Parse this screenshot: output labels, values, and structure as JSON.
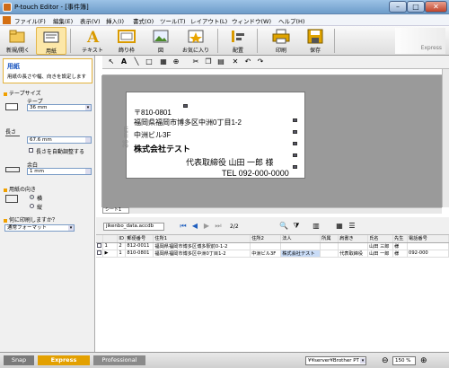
{
  "window": {
    "title": "P-touch Editor - [事件簿]",
    "controls": [
      "–",
      "□",
      "✕"
    ]
  },
  "menu": [
    "ファイル(F)",
    "編集(E)",
    "表示(V)",
    "挿入(I)",
    "書式(O)",
    "ツール(T)",
    "レイアウト(L)",
    "ウィンドウ(W)",
    "ヘルプ(H)"
  ],
  "ribbon": {
    "buttons": [
      "新規/開く",
      "用紙",
      "テキスト",
      "飾り枠",
      "図",
      "お気に入り",
      "配置",
      "印刷",
      "保存"
    ],
    "logo_text": "Express"
  },
  "left_panel": {
    "header_title": "用紙",
    "header_desc": "用紙の長さや幅、向きを設定します",
    "tape_size_label": "テープサイズ",
    "tape_label": "テープ",
    "tape_value": "36 mm",
    "length_label": "長さ",
    "length_value": "67.6 mm",
    "auto_length_label": "長さを自動調整する",
    "margin_label": "余白",
    "margin_value": "1 mm",
    "orientation_label": "用紙の向き",
    "orient_landscape": "横",
    "orient_portrait": "縦",
    "print_what_label": "何に印刷しますか？",
    "format_value": "通常フォーマット"
  },
  "label": {
    "side_text": "36 mm",
    "lines": [
      "〒810-0801",
      "福岡県福岡市博多区中洲0丁目1-2",
      "中洲ビル3F",
      "株式会社テスト",
      "代表取締役  山田  一郎  様",
      "TEL 092-000-0000"
    ]
  },
  "sheet_tab": "シート1",
  "database": {
    "filename": "jikenbo_data.accdb",
    "page": "2/2",
    "columns": [
      "",
      "",
      "ID",
      "郵便番号",
      "住所1",
      "住所2",
      "法人",
      "所属",
      "肩書き",
      "氏名",
      "先生",
      "電話番号"
    ],
    "rows": [
      [
        "",
        "1",
        "2",
        "812-0011",
        "福岡県福岡市博多区博多駅前0-1-2",
        "",
        "",
        "",
        "",
        "山田 三郎",
        "様",
        ""
      ],
      [
        "",
        "▶",
        "1",
        "810-0801",
        "福岡県福岡市博多区中洲0丁目1-2",
        "中洲ビル3F",
        "株式会社テスト",
        "",
        "代表取締役",
        "山田 一郎",
        "様",
        "092-000"
      ]
    ]
  },
  "status": {
    "tabs": [
      "Snap",
      "Express",
      "Professional"
    ],
    "printer": "¥¥server¥Brother PT",
    "zoom": "150 %"
  },
  "colors": {
    "accent": "#f0a000",
    "express_tab": "#e3a000"
  }
}
